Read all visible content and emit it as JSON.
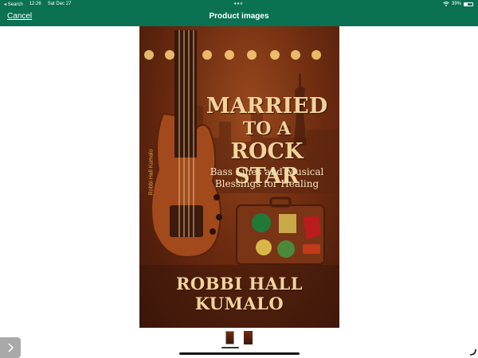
{
  "status_bar": {
    "back_app": "◂ Search",
    "time": "12:26",
    "date": "Sat Dec 27",
    "more_dots": "•••",
    "battery_percent": "39%",
    "battery_level": 0.39
  },
  "nav": {
    "cancel_label": "Cancel",
    "title": "Product images"
  },
  "cover": {
    "title_line1": "MARRIED",
    "title_line2": "TO A",
    "title_line3": "ROCK STAR",
    "subtitle": "Bass Lines and Musical Blessings for Healing",
    "author": "ROBBI HALL KUMALO",
    "spine_text": "Robbi Hall Kumalo"
  },
  "thumbnails": {
    "count": 2,
    "selected_index": 0
  },
  "icons": {
    "next": "chevron-right-icon",
    "wifi": "wifi-icon",
    "battery": "battery-icon",
    "corner": "resize-corner-icon"
  },
  "colors": {
    "brand_green": "#0a7152",
    "cover_gold": "#f2d49a",
    "cover_brown": "#6e2c10"
  }
}
